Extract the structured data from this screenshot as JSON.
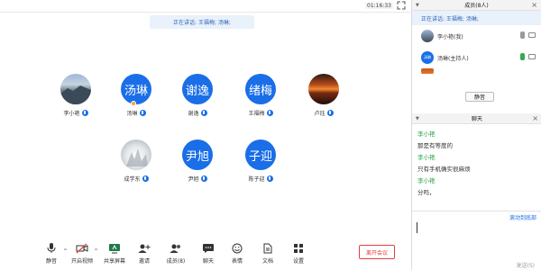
{
  "topbar": {
    "timer": "01:16:33"
  },
  "speaking_banner": "正在讲话: 王福梅; 汤琳;",
  "participants": [
    {
      "name": "李小艳",
      "avatar_text": "",
      "avatar_type": "photo-lake"
    },
    {
      "name": "汤琳",
      "avatar_text": "汤琳",
      "avatar_type": "blue"
    },
    {
      "name": "谢逸",
      "avatar_text": "谢逸",
      "avatar_type": "blue"
    },
    {
      "name": "王福梅",
      "avatar_text": "绪梅",
      "avatar_type": "blue"
    },
    {
      "name": "卢珏",
      "avatar_text": "",
      "avatar_type": "photo-sunset"
    },
    {
      "name": "成学东",
      "avatar_text": "",
      "avatar_type": "photo-snow"
    },
    {
      "name": "尹旭",
      "avatar_text": "尹旭",
      "avatar_type": "blue"
    },
    {
      "name": "陈子迎",
      "avatar_text": "子迎",
      "avatar_type": "blue"
    }
  ],
  "toolbar": {
    "mute": "静音",
    "video": "开启视频",
    "share": "共享屏幕",
    "invite": "邀请",
    "members": "成员(8)",
    "chat": "聊天",
    "emoji": "表情",
    "docs": "文档",
    "settings": "设置",
    "leave": "离开会议"
  },
  "members_panel": {
    "title": "成员(8人)",
    "speaking": "正在讲话: 王福梅; 汤琳;",
    "items": [
      {
        "name": "李小艳(我)",
        "mic_on": false
      },
      {
        "name": "汤琳(主持人)",
        "mic_on": true
      }
    ],
    "mute_all": "静音"
  },
  "chat_panel": {
    "title": "聊天",
    "messages": [
      {
        "sender": "李小艳",
        "text": "那是有等度的"
      },
      {
        "sender": "李小艳",
        "text": "只有手机确实很麻烦"
      },
      {
        "sender": "李小艳",
        "text": "分吗，"
      }
    ],
    "scroll_bottom": "滚动到底部",
    "send": "发送(S)"
  },
  "colors": {
    "accent": "#1a6ee8",
    "danger": "#e04040",
    "sender": "#2aa34a"
  }
}
